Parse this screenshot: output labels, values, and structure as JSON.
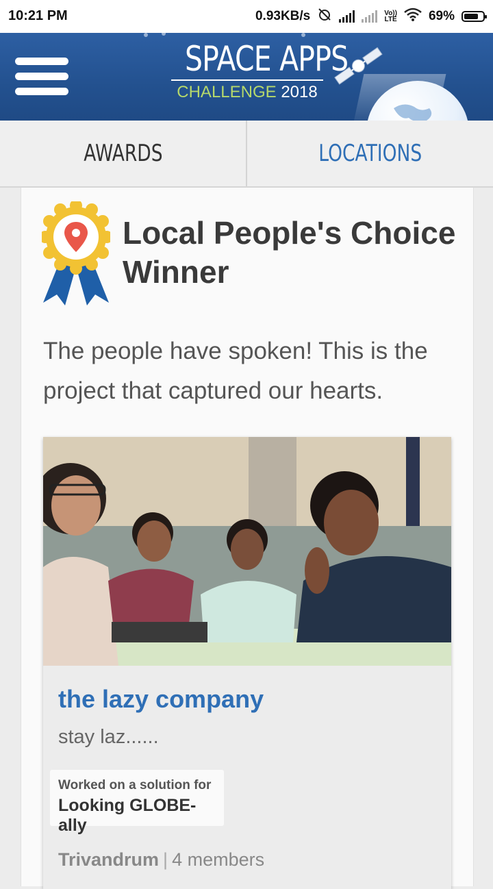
{
  "status_bar": {
    "time": "10:21 PM",
    "speed": "0.93KB/s",
    "battery": "69%",
    "lte_top": "Vo))",
    "lte_bottom": "LTE"
  },
  "header": {
    "logo_title": "SPACE APPS",
    "logo_sub_highlight": "CHALLENGE",
    "logo_sub_year": "2018"
  },
  "tabs": [
    {
      "label": "AWARDS"
    },
    {
      "label": "LOCATIONS"
    }
  ],
  "award": {
    "title": "Local People's Choice Winner",
    "description": "The people have spoken! This is the project that captured our hearts."
  },
  "project": {
    "name": "the lazy company",
    "tagline": "stay laz......",
    "solution_label": "Worked on a solution for",
    "solution_value": "Looking GLOBE-ally",
    "location": "Trivandrum",
    "separator": "|",
    "members": "4 members"
  },
  "colors": {
    "header_blue": "#23518f",
    "link_blue": "#2f6fb6",
    "logo_green": "#b6d96b",
    "ribbon_yellow": "#f2c233",
    "ribbon_blue": "#1f5fa8",
    "pin_red": "#e9574a"
  }
}
